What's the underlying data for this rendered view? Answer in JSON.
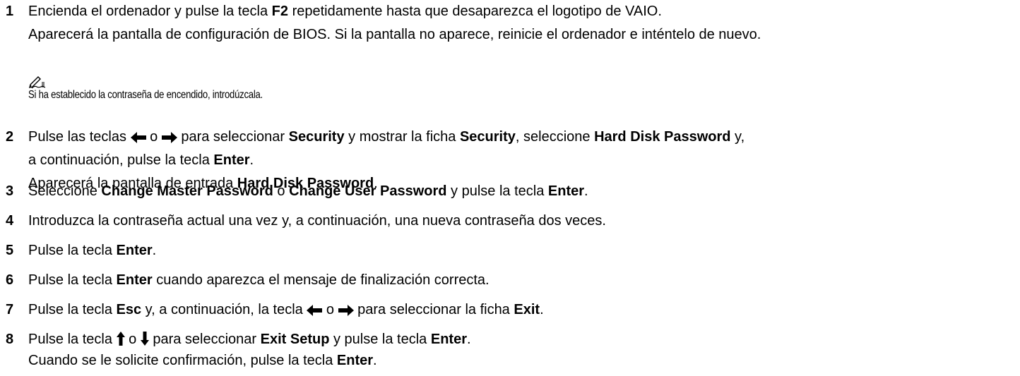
{
  "steps": [
    {
      "number": "1",
      "lines": [
        [
          {
            "t": "Encienda el ordenador y pulse la tecla "
          },
          {
            "t": "F2",
            "b": true
          },
          {
            "t": " repetidamente hasta que desaparezca el logotipo de VAIO."
          }
        ],
        [
          {
            "t": "Aparecerá la pantalla de configuración de BIOS. Si la pantalla no aparece, reinicie el ordenador e inténtelo de nuevo."
          }
        ]
      ]
    },
    {
      "number": "2",
      "lines": [
        [
          {
            "t": "Pulse las teclas "
          },
          {
            "icon": "left-arrow"
          },
          {
            "t": " o "
          },
          {
            "icon": "right-arrow"
          },
          {
            "t": " para seleccionar "
          },
          {
            "t": "Security",
            "b": true
          },
          {
            "t": " y mostrar la ficha "
          },
          {
            "t": "Security",
            "b": true
          },
          {
            "t": ", seleccione "
          },
          {
            "t": "Hard Disk Password",
            "b": true
          },
          {
            "t": " y,"
          }
        ],
        [
          {
            "t": "a continuación, pulse la tecla "
          },
          {
            "t": "Enter",
            "b": true
          },
          {
            "t": "."
          }
        ],
        [
          {
            "t": "Aparecerá la pantalla de entrada "
          },
          {
            "t": "Hard Disk Password",
            "b": true
          },
          {
            "t": "."
          }
        ]
      ]
    },
    {
      "number": "3",
      "lines": [
        [
          {
            "t": "Seleccione "
          },
          {
            "t": "Change Master Password",
            "b": true
          },
          {
            "t": " o "
          },
          {
            "t": "Change User Password",
            "b": true
          },
          {
            "t": " y pulse la tecla "
          },
          {
            "t": "Enter",
            "b": true
          },
          {
            "t": "."
          }
        ]
      ]
    },
    {
      "number": "4",
      "lines": [
        [
          {
            "t": "Introduzca la contraseña actual una vez y, a continuación, una nueva contraseña dos veces."
          }
        ]
      ]
    },
    {
      "number": "5",
      "lines": [
        [
          {
            "t": "Pulse la tecla "
          },
          {
            "t": "Enter",
            "b": true
          },
          {
            "t": "."
          }
        ]
      ]
    },
    {
      "number": "6",
      "lines": [
        [
          {
            "t": "Pulse la tecla "
          },
          {
            "t": "Enter",
            "b": true
          },
          {
            "t": " cuando aparezca el mensaje de finalización correcta."
          }
        ]
      ]
    },
    {
      "number": "7",
      "lines": [
        [
          {
            "t": "Pulse la tecla "
          },
          {
            "t": "Esc",
            "b": true
          },
          {
            "t": " y, a continuación, la tecla "
          },
          {
            "icon": "left-arrow"
          },
          {
            "t": " o "
          },
          {
            "icon": "right-arrow"
          },
          {
            "t": " para seleccionar la ficha "
          },
          {
            "t": "Exit",
            "b": true
          },
          {
            "t": "."
          }
        ]
      ]
    },
    {
      "number": "8",
      "lines": [
        [
          {
            "t": "Pulse la tecla "
          },
          {
            "icon": "up-arrow"
          },
          {
            "t": " o "
          },
          {
            "icon": "down-arrow"
          },
          {
            "t": " para seleccionar "
          },
          {
            "t": "Exit Setup",
            "b": true
          },
          {
            "t": " y pulse la tecla "
          },
          {
            "t": "Enter",
            "b": true
          },
          {
            "t": "."
          }
        ],
        [
          {
            "t": "Cuando se le solicite confirmación, pulse la tecla "
          },
          {
            "t": "Enter",
            "b": true
          },
          {
            "t": "."
          }
        ]
      ]
    }
  ],
  "note": {
    "icon": "note-pencil-icon",
    "text": "Si ha establecido la contraseña de encendido, introdúzcala."
  }
}
